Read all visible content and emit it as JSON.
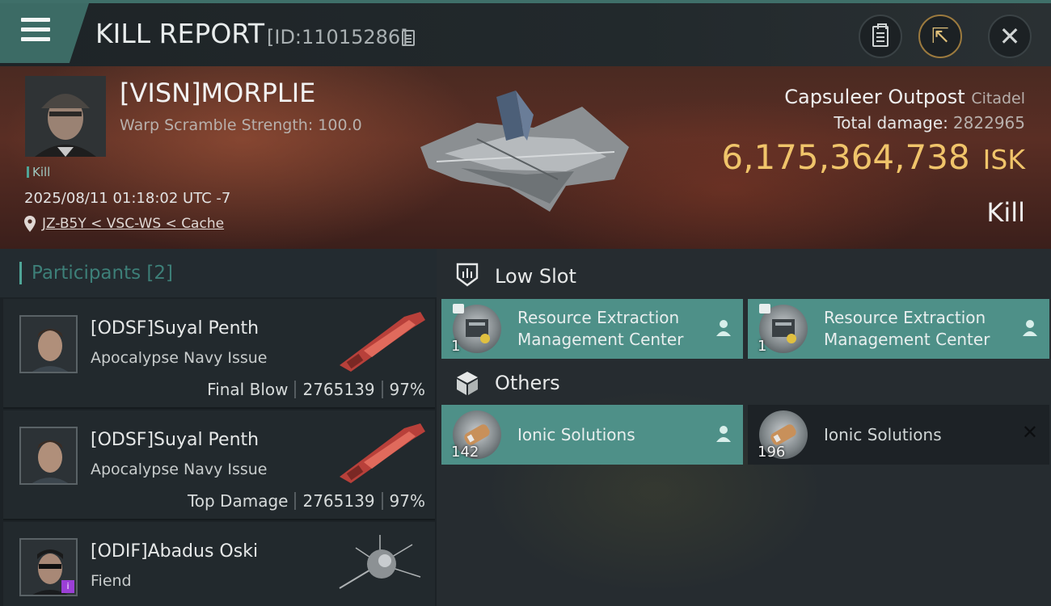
{
  "header": {
    "title": "KILL REPORT",
    "report_id": "[ID:11015286]"
  },
  "victim": {
    "name": "[VISN]MORPLIE",
    "subtitle": "Warp Scramble Strength: 100.0",
    "tag": "Kill",
    "datetime": "2025/08/11 01:18:02 UTC -7",
    "location": "JZ-B5Y < VSC-WS < Cache"
  },
  "target": {
    "name": "Capsuleer Outpost",
    "class": "Citadel",
    "total_damage_label": "Total damage:",
    "total_damage_value": "2822965",
    "isk_value": "6,175,364,738",
    "isk_unit": "ISK",
    "result": "Kill"
  },
  "participants": {
    "label": "Participants",
    "count": "[2]",
    "rows": [
      {
        "name": "[ODSF]Suyal Penth",
        "ship": "Apocalypse Navy Issue",
        "role": "Final Blow",
        "damage": "2765139",
        "percent": "97%"
      },
      {
        "name": "[ODSF]Suyal Penth",
        "ship": "Apocalypse Navy Issue",
        "role": "Top Damage",
        "damage": "2765139",
        "percent": "97%"
      },
      {
        "name": "[ODIF]Abadus Oski",
        "ship": "Fiend"
      }
    ]
  },
  "sections": {
    "low_slot": {
      "title": "Low Slot",
      "items": [
        {
          "name_line1": "Resource Extraction",
          "name_line2": "Management Center",
          "qty": "1"
        },
        {
          "name_line1": "Resource Extraction",
          "name_line2": "Management Center",
          "qty": "1"
        }
      ]
    },
    "others": {
      "title": "Others",
      "items": [
        {
          "name": "Ionic Solutions",
          "qty": "142"
        },
        {
          "name": "Ionic Solutions",
          "qty": "196"
        }
      ]
    }
  },
  "colors": {
    "accent_teal": "#4e9088",
    "isk_gold": "#f0c46a",
    "banner_red": "#5a2e24"
  },
  "icons": [
    "menu-icon",
    "copy-icon",
    "clipboard-icon",
    "share-icon",
    "close-icon",
    "location-pin-icon",
    "low-slot-icon",
    "cube-icon",
    "person-icon",
    "x-icon"
  ]
}
